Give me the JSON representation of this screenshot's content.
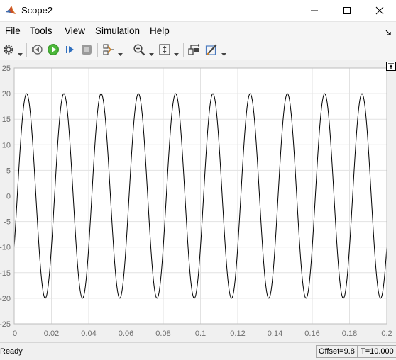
{
  "window": {
    "title": "Scope2",
    "icon": "matlab-icon",
    "controls": [
      "minimize-icon",
      "maximize-icon",
      "close-icon"
    ]
  },
  "menu": {
    "items": [
      {
        "mnemonic": "F",
        "rest": "ile"
      },
      {
        "mnemonic": "T",
        "rest": "ools"
      },
      {
        "mnemonic": "V",
        "rest": "iew"
      },
      {
        "pre": "S",
        "mnemonic": "i",
        "rest": "mulation"
      },
      {
        "mnemonic": "H",
        "rest": "elp"
      }
    ]
  },
  "toolbar": {
    "icons": [
      "settings-gear-icon",
      "step-back-icon",
      "run-icon",
      "step-forward-icon",
      "stop-icon",
      "signal-selector-icon",
      "zoom-icon",
      "scale-axes-icon",
      "highlight-simulink-block-icon",
      "style-icon"
    ]
  },
  "status": {
    "state": "Ready",
    "offset": "Offset=9.8",
    "time": "T=10.000"
  },
  "colors": {
    "plot_background": "#ffffff",
    "trace": "#000000",
    "grid": "#e2e2e2",
    "tick_label": "#6e6e6e"
  },
  "chart_data": {
    "type": "line",
    "title": "",
    "xlabel": "",
    "ylabel": "",
    "xlim": [
      0,
      0.2
    ],
    "ylim": [
      -25,
      25
    ],
    "x_ticks": [
      "0",
      "0.02",
      "0.04",
      "0.06",
      "0.08",
      "0.1",
      "0.12",
      "0.14",
      "0.16",
      "0.18",
      "0.2"
    ],
    "y_ticks": [
      "25",
      "20",
      "15",
      "10",
      "5",
      "0",
      "-5",
      "-10",
      "-15",
      "-20",
      "-25"
    ],
    "grid": true,
    "series": [
      {
        "amplitude": 20,
        "frequency_hz": 50,
        "phase_deg": -30,
        "x_start": 0,
        "x_end": 0.2,
        "samples": 800
      }
    ]
  }
}
